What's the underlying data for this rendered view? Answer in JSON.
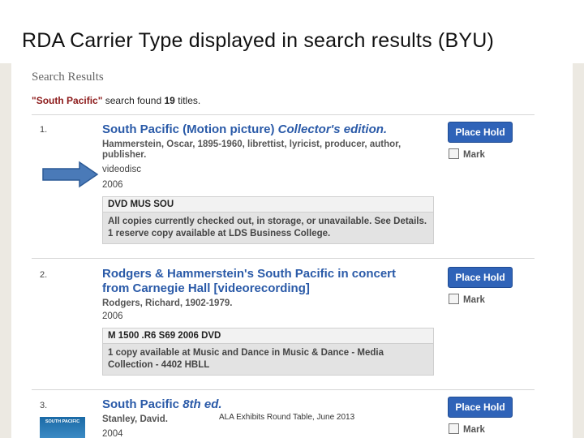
{
  "slide": {
    "title": "RDA Carrier Type displayed in search results (BYU)",
    "footer": "ALA Exhibits Round Table, June 2013"
  },
  "search": {
    "heading": "Search Results",
    "query": "\"South Pacific\"",
    "found_prefix": "search found",
    "count": "19",
    "found_suffix": "titles."
  },
  "results": [
    {
      "num": "1.",
      "title_main": "South Pacific (Motion picture)",
      "title_edition": "Collector's edition.",
      "author": "Hammerstein, Oscar, 1895-1960, librettist, lyricist, producer, author, publisher.",
      "carrier": "videodisc",
      "year": "2006",
      "call_number": "DVD MUS SOU",
      "availability": "All copies currently checked out, in storage, or unavailable. See Details. 1 reserve copy available at LDS Business College.",
      "hold_label": "Place Hold",
      "mark_label": "Mark"
    },
    {
      "num": "2.",
      "title_main": "Rodgers & Hammerstein's South Pacific in concert from Carnegie Hall [videorecording]",
      "author": "Rodgers, Richard, 1902-1979.",
      "year": "2006",
      "call_number": "M 1500 .R6 S69 2006 DVD",
      "availability": "1 copy available at Music and Dance in Music & Dance - Media Collection - 4402 HBLL",
      "hold_label": "Place Hold",
      "mark_label": "Mark"
    },
    {
      "num": "3.",
      "title_main": "South Pacific",
      "title_edition": "8th ed.",
      "author": "Stanley, David.",
      "year": "2004",
      "cover_text": "SOUTH PACIFIC",
      "hold_label": "Place Hold",
      "mark_label": "Mark"
    }
  ],
  "colors": {
    "link": "#2a5aa8",
    "hold_button": "#2f63b8",
    "query": "#8c1a1a",
    "arrow": "#4a7ab8"
  }
}
